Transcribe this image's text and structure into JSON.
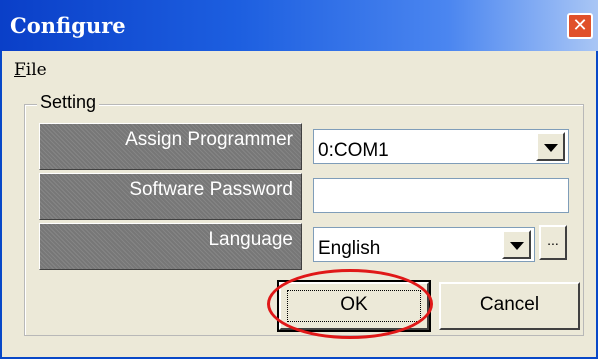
{
  "window": {
    "title": "Configure",
    "close_glyph": "✕"
  },
  "menu": {
    "file_label": "File"
  },
  "setting": {
    "group_label": "Setting",
    "assign_programmer": {
      "label": "Assign Programmer",
      "value": "0:COM1"
    },
    "software_password": {
      "label": "Software Password",
      "value": ""
    },
    "language": {
      "label": "Language",
      "value": "English",
      "browse_label": "..."
    }
  },
  "buttons": {
    "ok_label": "OK",
    "cancel_label": "Cancel"
  },
  "icons": {
    "close": "close-icon",
    "dropdown": "chevron-down-icon"
  },
  "colors": {
    "title_bar": "#0a3fc8",
    "highlight": "#e01818",
    "window_bg": "#ece9d8"
  }
}
